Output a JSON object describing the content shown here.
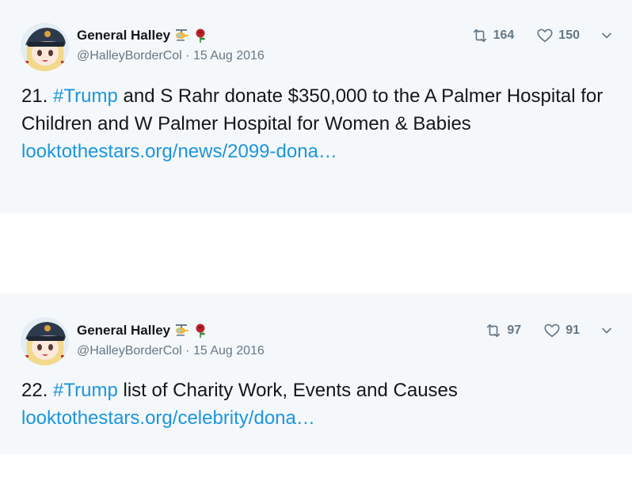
{
  "colors": {
    "link": "#1b95e0",
    "muted": "#657786",
    "text": "#14171a",
    "card_bg": "#f5f8fa"
  },
  "tweets": [
    {
      "author": {
        "display_name": "General Halley",
        "badges": [
          "helicopter-emoji-icon",
          "rose-emoji-icon"
        ],
        "handle": "@HalleyBorderCol",
        "date": "15 Aug 2016",
        "separator": " · "
      },
      "stats": {
        "retweets": "164",
        "likes": "150"
      },
      "text": {
        "prefix": "21. ",
        "hashtag": "#Trump",
        "body": " and S Rahr donate $350,000 to the A Palmer Hospital for Children and W Palmer Hospital for Women & Babies",
        "link": "looktothestars.org/news/2099-dona…"
      }
    },
    {
      "author": {
        "display_name": "General Halley",
        "badges": [
          "helicopter-emoji-icon",
          "rose-emoji-icon"
        ],
        "handle": "@HalleyBorderCol",
        "date": "15 Aug 2016",
        "separator": " · "
      },
      "stats": {
        "retweets": "97",
        "likes": "91"
      },
      "text": {
        "prefix": "22. ",
        "hashtag": "#Trump",
        "body": " list of Charity Work, Events and Causes",
        "link": "looktothestars.org/celebrity/dona…"
      }
    }
  ]
}
